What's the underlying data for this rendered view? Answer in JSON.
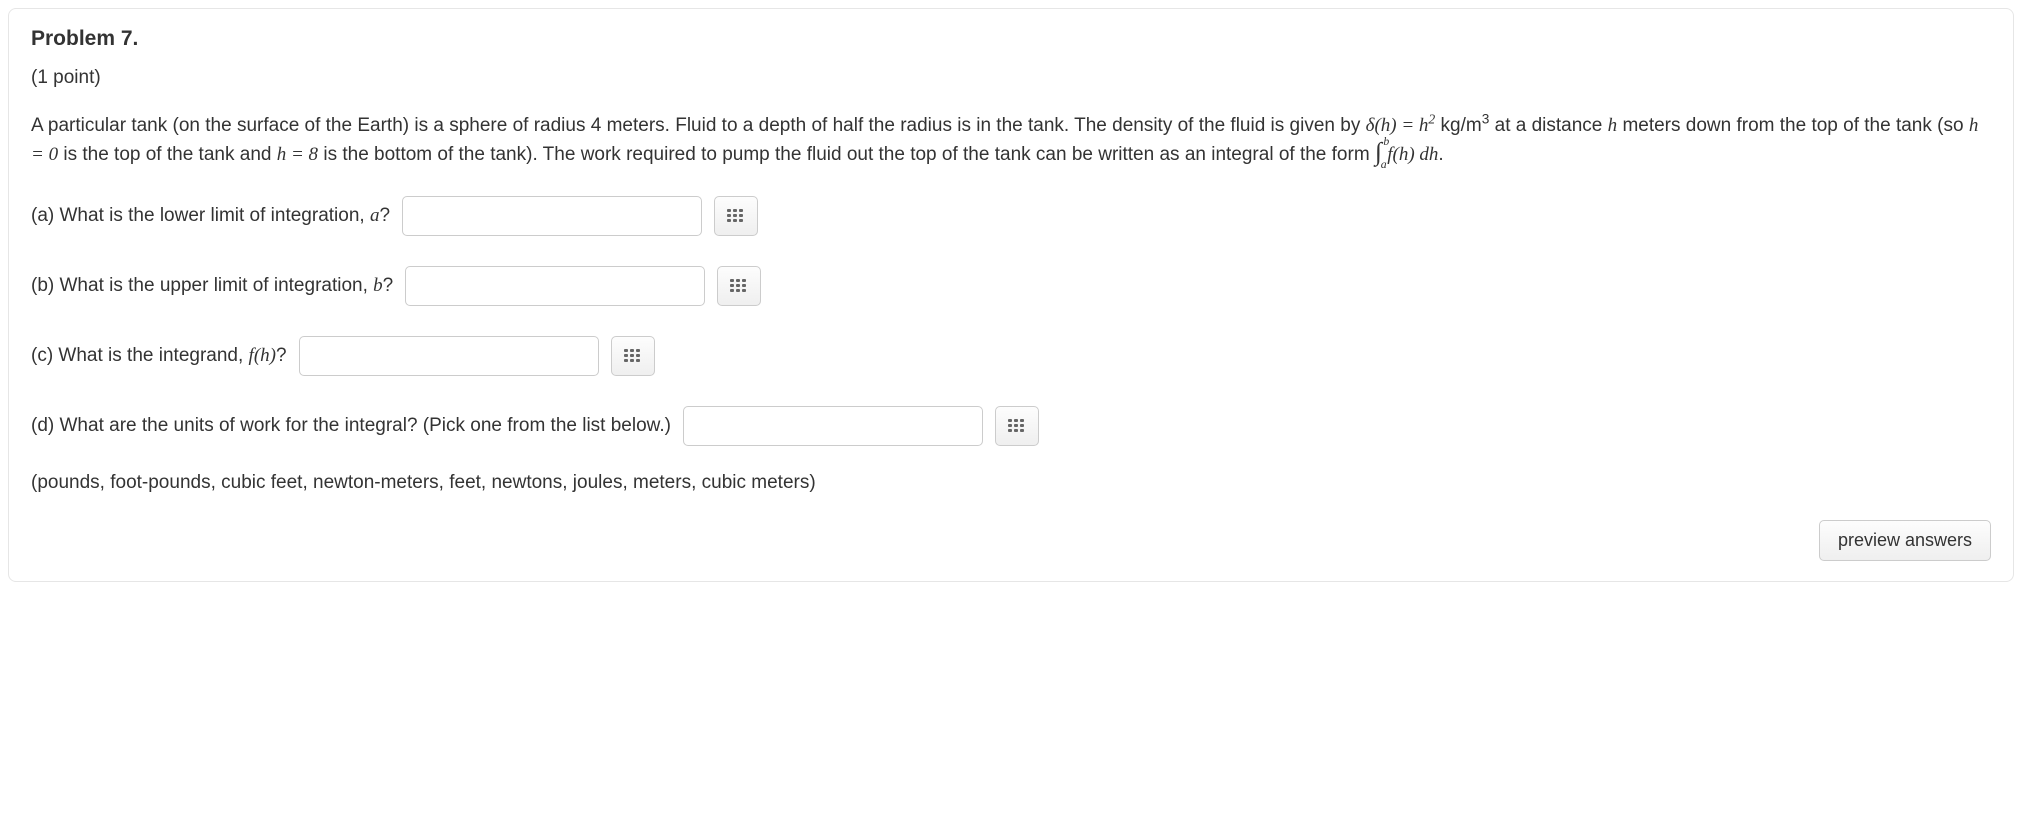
{
  "problem": {
    "title": "Problem 7.",
    "points": "(1 point)",
    "body_seg1": "A particular tank (on the surface of the Earth) is a sphere of radius 4 meters. Fluid to a depth of half the radius is in the tank. The density of the fluid is given by ",
    "density_lhs": "δ(h) = h",
    "density_exp": "2",
    "density_units_pre": "  kg/m",
    "density_units_exp": "3",
    "body_seg2": " at a distance ",
    "h_var": "h",
    "body_seg3": " meters down from the top of the tank (so ",
    "h_eq0": "h = 0",
    "body_seg4": " is the top of the tank and ",
    "h_eq8": "h = 8",
    "body_seg5": " is the bottom of the tank). The work required to pump the fluid out the top of the tank can be written as an integral of the form ",
    "int_upper": "b",
    "int_lower": "a",
    "integrand": "f(h) dh",
    "body_end": ".",
    "qa_pre": "(a) What is the lower limit of integration, ",
    "qa_var": "a",
    "q_end": "?",
    "qb_pre": "(b) What is the upper limit of integration, ",
    "qb_var": "b",
    "qc_pre": "(c) What is the integrand, ",
    "qc_var": "f(h)",
    "qd": "(d) What are the units of work for the integral? (Pick one from the list below.)",
    "options": "(pounds, foot-pounds, cubic feet, newton-meters, feet, newtons, joules, meters, cubic meters)",
    "preview_label": "preview answers"
  },
  "inputs": {
    "a_value": "",
    "b_value": "",
    "c_value": "",
    "d_value": ""
  }
}
